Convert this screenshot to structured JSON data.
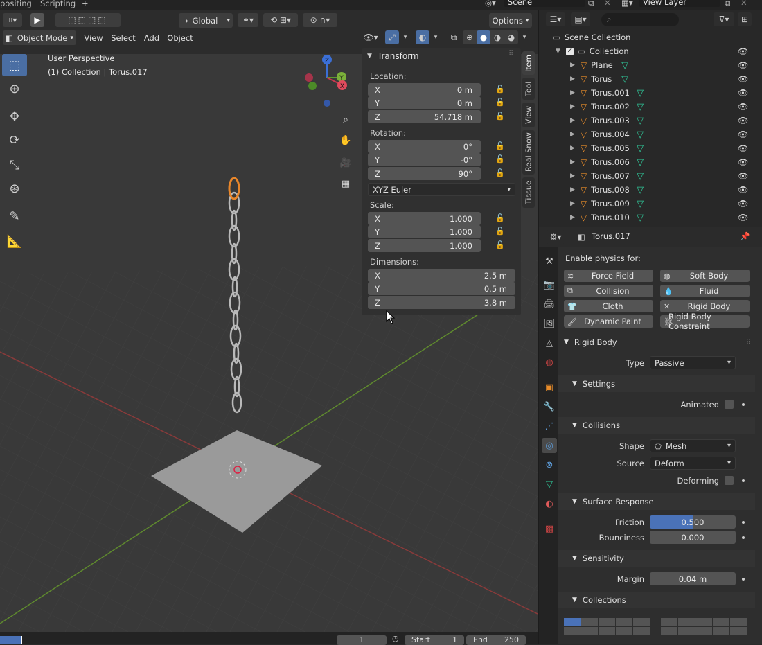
{
  "topbar": {
    "workspace_tabs": [
      "positing",
      "Scripting"
    ],
    "add_tab": "+",
    "scene": "Scene",
    "view_layer": "View Layer"
  },
  "viewport_header": {
    "orientation": "Global",
    "options": "Options",
    "mode": "Object Mode",
    "menus": [
      "View",
      "Select",
      "Add",
      "Object"
    ]
  },
  "overlay": {
    "perspective": "User Perspective",
    "collection": "(1) Collection | Torus.017"
  },
  "gizmo": {
    "x": "X",
    "y": "Y",
    "z": "Z"
  },
  "npanel": {
    "title": "Transform",
    "location_label": "Location:",
    "location": [
      {
        "axis": "X",
        "value": "0 m"
      },
      {
        "axis": "Y",
        "value": "0 m"
      },
      {
        "axis": "Z",
        "value": "54.718 m"
      }
    ],
    "rotation_label": "Rotation:",
    "rotation": [
      {
        "axis": "X",
        "value": "0°"
      },
      {
        "axis": "Y",
        "value": "-0°"
      },
      {
        "axis": "Z",
        "value": "90°"
      }
    ],
    "rotation_mode": "XYZ Euler",
    "scale_label": "Scale:",
    "scale": [
      {
        "axis": "X",
        "value": "1.000"
      },
      {
        "axis": "Y",
        "value": "1.000"
      },
      {
        "axis": "Z",
        "value": "1.000"
      }
    ],
    "dimensions_label": "Dimensions:",
    "dimensions": [
      {
        "axis": "X",
        "value": "2.5 m"
      },
      {
        "axis": "Y",
        "value": "0.5 m"
      },
      {
        "axis": "Z",
        "value": "3.8 m"
      }
    ],
    "tabs": [
      "Item",
      "Tool",
      "View",
      "Real Snow",
      "Tissue"
    ]
  },
  "outliner": {
    "root": "Scene Collection",
    "collection": "Collection",
    "items": [
      "Plane",
      "Torus",
      "Torus.001",
      "Torus.002",
      "Torus.003",
      "Torus.004",
      "Torus.005",
      "Torus.006",
      "Torus.007",
      "Torus.008",
      "Torus.009",
      "Torus.010"
    ]
  },
  "properties": {
    "object_name": "Torus.017",
    "enable_physics": "Enable physics for:",
    "physics_buttons": [
      {
        "label": "Force Field",
        "icon": "≋"
      },
      {
        "label": "Soft Body",
        "icon": "◍"
      },
      {
        "label": "Collision",
        "icon": "⧉"
      },
      {
        "label": "Fluid",
        "icon": "💧"
      },
      {
        "label": "Cloth",
        "icon": "👕"
      },
      {
        "label": "Rigid Body",
        "icon": "✕"
      },
      {
        "label": "Dynamic Paint",
        "icon": "🖌"
      },
      {
        "label": "Rigid Body Constraint",
        "icon": "⛓"
      }
    ],
    "rigid_body": {
      "title": "Rigid Body",
      "type_label": "Type",
      "type_value": "Passive",
      "settings": "Settings",
      "animated_label": "Animated",
      "collisions": "Collisions",
      "shape_label": "Shape",
      "shape_value": "Mesh",
      "source_label": "Source",
      "source_value": "Deform",
      "deforming_label": "Deforming",
      "surface_response": "Surface Response",
      "friction_label": "Friction",
      "friction_value": "0.500",
      "friction_fraction": 0.5,
      "bounciness_label": "Bounciness",
      "bounciness_value": "0.000",
      "sensitivity": "Sensitivity",
      "margin_label": "Margin",
      "margin_value": "0.04 m",
      "collections": "Collections"
    }
  },
  "timeline": {
    "current_frame": "1",
    "start_label": "Start",
    "start": "1",
    "end_label": "End",
    "end": "250"
  }
}
